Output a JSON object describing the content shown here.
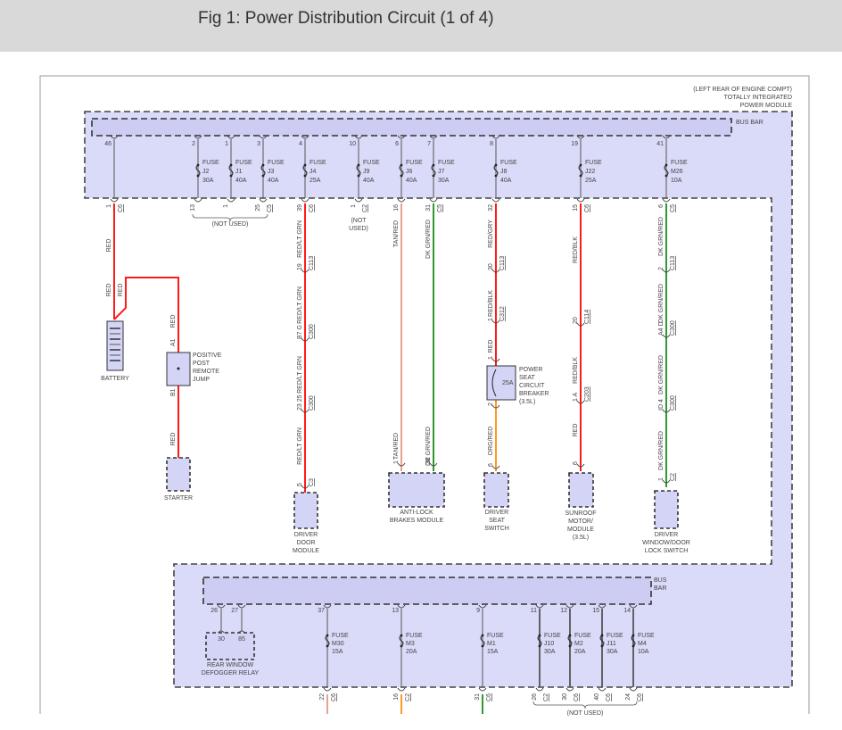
{
  "header": {
    "title": "Fig 1: Power Distribution Circuit (1 of 4)"
  },
  "module": {
    "location": "(LEFT REAR OF ENGINE COMPT)",
    "name_line1": "TOTALLY INTEGRATED",
    "name_line2": "POWER MODULE",
    "bus_bar": "BUS BAR",
    "bus_bar_lower": [
      "BUS",
      "BAR"
    ]
  },
  "colors": {
    "module_fill": "#dadaf9",
    "bus_fill": "#cdcdf4",
    "component_fill": "#d4d4f7",
    "red": "#ff1a1a",
    "green": "#2e9a2e",
    "tan": "#eba08f",
    "orange": "#ff9a26",
    "internal": "#555555"
  },
  "top_fuses": [
    {
      "pin": "46",
      "out_pin": "1",
      "out_conn": "C6"
    },
    {
      "pin": "2",
      "fuse": "FUSE",
      "id": "J2",
      "rating": "30A",
      "out_pin": "13"
    },
    {
      "pin": "1",
      "fuse": "FUSE",
      "id": "J1",
      "rating": "40A",
      "out_pin": "1"
    },
    {
      "pin": "3",
      "fuse": "FUSE",
      "id": "J3",
      "rating": "40A",
      "out_pin": "25",
      "out_conn": "C5"
    },
    {
      "pin": "4",
      "fuse": "FUSE",
      "id": "J4",
      "rating": "25A",
      "out_pin": "39",
      "out_conn": "C6"
    },
    {
      "pin": "10",
      "fuse": "FUSE",
      "id": "J9",
      "rating": "40A",
      "out_pin": "1",
      "out_conn": "C2"
    },
    {
      "pin": "6",
      "fuse": "FUSE",
      "id": "J6",
      "rating": "40A",
      "out_pin": "16"
    },
    {
      "pin": "7",
      "fuse": "FUSE",
      "id": "J7",
      "rating": "30A",
      "out_pin": "31",
      "out_conn": "C5"
    },
    {
      "pin": "8",
      "fuse": "FUSE",
      "id": "J8",
      "rating": "40A",
      "out_pin": "32"
    },
    {
      "pin": "19",
      "fuse": "FUSE",
      "id": "J22",
      "rating": "25A",
      "out_pin": "15",
      "out_conn": "C6"
    },
    {
      "pin": "41",
      "fuse": "FUSE",
      "id": "M26",
      "rating": "10A",
      "out_pin": "6",
      "out_conn": "C5"
    }
  ],
  "not_used": "(NOT USED)",
  "not_used_split": [
    "(NOT",
    "USED)"
  ],
  "wire_labels": [
    "RED",
    "RED",
    "RED",
    "RED",
    "RED",
    "RED/LT GRN",
    "RED/LT GRN",
    "RED/LT GRN",
    "RED/LT GRN",
    "TAN/RED",
    "DK GRN/RED",
    "TAN/RED",
    "DK GRN/RED",
    "RED/GRY",
    "RED/BLK",
    "RED",
    "ORG/RED",
    "RED/BLK",
    "RED/BLK",
    "RED",
    "DK GRN/RED",
    "DK GRN/RED",
    "DK GRN/RED",
    "DK GRN/RED"
  ],
  "inline_connectors": [
    {
      "pins": "19",
      "conn": "C113"
    },
    {
      "pins": "B7  G",
      "conn": "C300"
    },
    {
      "pins": "23  25",
      "conn": "C300"
    },
    {
      "pins": "5",
      "conn": "C3"
    },
    {
      "pins": "1"
    },
    {
      "pins": "32"
    },
    {
      "pins": "30",
      "conn": "C113"
    },
    {
      "pins": "1",
      "conn": "C312"
    },
    {
      "pins": "1"
    },
    {
      "pins": "2"
    },
    {
      "pins": "6"
    },
    {
      "pins": "20",
      "conn": "C114"
    },
    {
      "pins": "1  A",
      "conn": "C203"
    },
    {
      "pins": "6"
    },
    {
      "pins": "2",
      "conn": "C113"
    },
    {
      "pins": "A4  D",
      "conn": "C300"
    },
    {
      "pins": "ID  4",
      "conn": "C300"
    },
    {
      "pins": "1",
      "conn": "C2"
    },
    {
      "pins": "A1"
    },
    {
      "pins": "B1"
    }
  ],
  "components": {
    "battery": [
      "BATTERY"
    ],
    "remote_jump": [
      "POSITIVE",
      "POST",
      "REMOTE",
      "JUMP"
    ],
    "starter": [
      "STARTER"
    ],
    "driver_door_module": [
      "DRIVER",
      "DOOR",
      "MODULE"
    ],
    "abs": [
      "ANTI-LOCK",
      "BRAKES MODULE"
    ],
    "seat_breaker": {
      "rating": "25A",
      "lines": [
        "POWER",
        "SEAT",
        "CIRCUIT",
        "BREAKER",
        "(3.5L)"
      ]
    },
    "driver_seat_switch": [
      "DRIVER",
      "SEAT",
      "SWITCH"
    ],
    "sunroof": [
      "SUNROOF",
      "MOTOR/",
      "MODULE",
      "(3.5L)"
    ],
    "window_switch": [
      "DRIVER",
      "WINDOW/DOOR",
      "LOCK SWITCH"
    ],
    "defogger_relay": {
      "pins": [
        "30",
        "85"
      ],
      "lines": [
        "REAR WINDOW",
        "DEFOGGER RELAY"
      ]
    }
  },
  "relay_bus_pins": [
    "26",
    "27"
  ],
  "bottom_fuses": [
    {
      "pin": "37",
      "fuse": "FUSE",
      "id": "M30",
      "rating": "15A",
      "out_pin": "22",
      "out_conn": "C6"
    },
    {
      "pin": "13",
      "fuse": "FUSE",
      "id": "M3",
      "rating": "20A",
      "out_pin": "16",
      "out_conn": "C2"
    },
    {
      "pin": "9",
      "fuse": "FUSE",
      "id": "M1",
      "rating": "15A",
      "out_pin": "31",
      "out_conn": "C6"
    },
    {
      "pin": "11",
      "fuse": "FUSE",
      "id": "J10",
      "rating": "30A",
      "out_pin": "26",
      "out_conn": "C2"
    },
    {
      "pin": "12",
      "fuse": "FUSE",
      "id": "M2",
      "rating": "20A",
      "out_pin": "30",
      "out_conn": "C6"
    },
    {
      "pin": "15",
      "fuse": "FUSE",
      "id": "J11",
      "rating": "30A",
      "out_pin": "40",
      "out_conn": "C6"
    },
    {
      "pin": "14",
      "fuse": "FUSE",
      "id": "M4",
      "rating": "10A",
      "out_pin": "24",
      "out_conn": "C6"
    }
  ]
}
